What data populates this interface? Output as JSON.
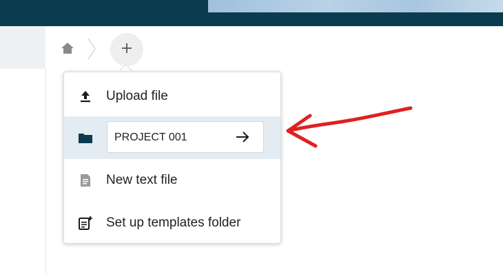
{
  "header": {
    "title_fragment": "",
    "accent": "#0b3b4f"
  },
  "breadcrumb": {
    "home_icon": "home-icon",
    "separator_icon": "chevron-right-icon"
  },
  "new_menu": {
    "trigger_icon": "plus-icon",
    "items": [
      {
        "label": "Upload file",
        "icon": "upload-icon"
      },
      {
        "label": "",
        "icon": "folder-icon",
        "input_value": "PROJECT 001",
        "submit_icon": "arrow-right-icon"
      },
      {
        "label": "New text file",
        "icon": "text-file-icon"
      },
      {
        "label": "Set up templates folder",
        "icon": "template-icon"
      }
    ]
  },
  "annotation": {
    "type": "hand-drawn-arrow",
    "color": "#e02020"
  }
}
